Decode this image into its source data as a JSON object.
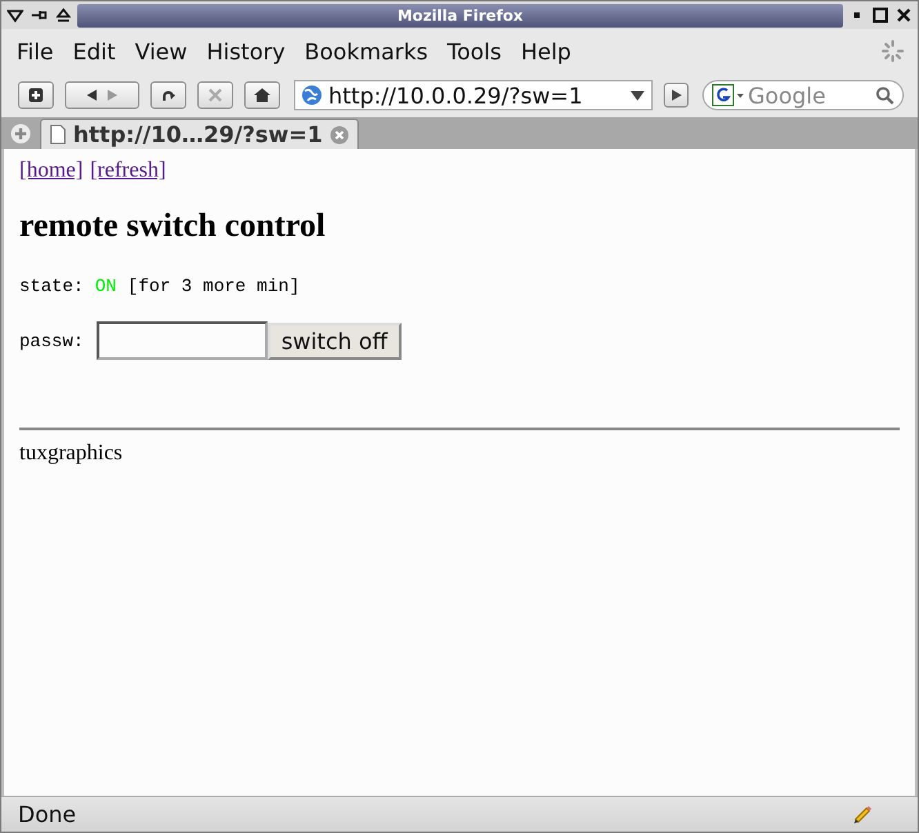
{
  "window": {
    "title": "Mozilla Firefox"
  },
  "menu": [
    "File",
    "Edit",
    "View",
    "History",
    "Bookmarks",
    "Tools",
    "Help"
  ],
  "address": {
    "value": "http://10.0.0.29/?sw=1"
  },
  "search": {
    "placeholder": "Google"
  },
  "tabs": [
    {
      "label": "http://10…29/?sw=1",
      "selected": true
    }
  ],
  "page": {
    "links": [
      "[home]",
      "[refresh]"
    ],
    "heading": "remote switch control",
    "state_label": "state:",
    "state_value": "ON",
    "state_on": true,
    "state_note": "[for 3 more min]",
    "password_label": "passw:",
    "button": "switch off",
    "footer": "tuxgraphics"
  },
  "status_bar": {
    "text": "Done"
  }
}
